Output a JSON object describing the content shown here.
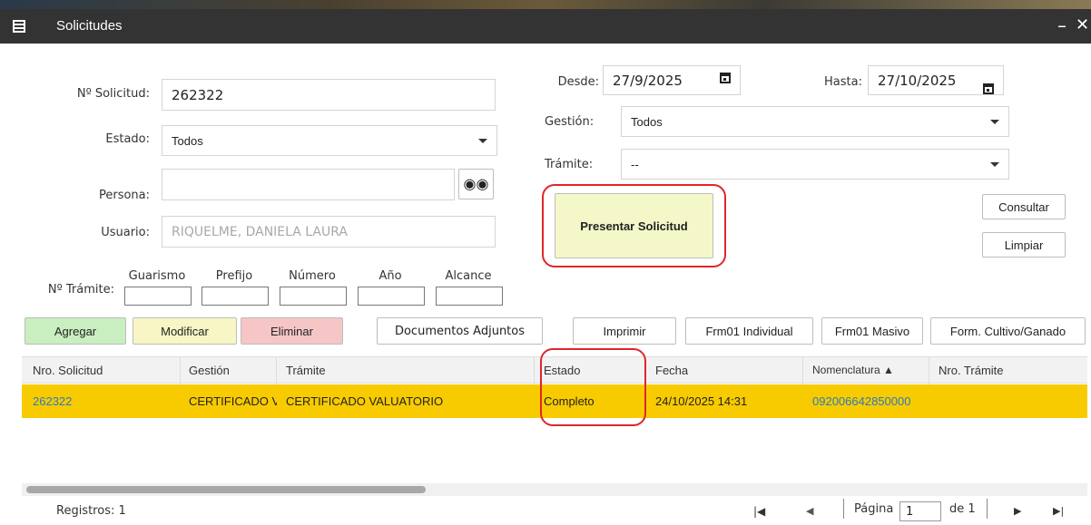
{
  "window": {
    "title": "Solicitudes",
    "minimize": "–",
    "close": "✕"
  },
  "form": {
    "nro_solicitud": {
      "label": "Nº Solicitud:",
      "value": "262322"
    },
    "estado": {
      "label": "Estado:",
      "value": "Todos"
    },
    "persona": {
      "label": "Persona:",
      "value": ""
    },
    "usuario": {
      "label": "Usuario:",
      "value": "RIQUELME, DANIELA LAURA"
    },
    "tramite_nro": {
      "label": "Nº Trámite:",
      "subs": [
        "Guarismo",
        "Prefijo",
        "Número",
        "Año",
        "Alcance"
      ]
    },
    "desde": {
      "label": "Desde:",
      "value": "27/9/2025"
    },
    "hasta": {
      "label": "Hasta:",
      "value": "27/10/2025"
    },
    "gestion": {
      "label": "Gestión:",
      "value": "Todos"
    },
    "tramite": {
      "label": "Trámite:",
      "value": "--"
    }
  },
  "buttons": {
    "presentar": "Presentar Solicitud",
    "consultar": "Consultar",
    "limpiar": "Limpiar",
    "agregar": "Agregar",
    "modificar": "Modificar",
    "eliminar": "Eliminar",
    "documentos": "Documentos Adjuntos",
    "imprimir": "Imprimir",
    "frm_individual": "Frm01 Individual",
    "frm_masivo": "Frm01 Masivo",
    "form_cultivo": "Form. Cultivo/Ganado"
  },
  "grid": {
    "columns": [
      "Nro. Solicitud",
      "Gestión",
      "Trámite",
      "Estado",
      "Fecha",
      "Nomenclatura ▲",
      "Nro. Trámite"
    ],
    "rows": [
      {
        "nro_solicitud": "262322",
        "gestion": "CERTIFICADO VALUATORIO",
        "tramite": "CERTIFICADO VALUATORIO",
        "estado": "Completo",
        "fecha": "24/10/2025 14:31",
        "nomenclatura": "092006642850000",
        "nro_tramite": ""
      }
    ]
  },
  "footer": {
    "registros": "Registros: 1",
    "pagina_label": "Página",
    "pagina_value": "1",
    "de": "de 1",
    "first": "|◀",
    "prev": "◀",
    "next": "▶",
    "last": "▶|"
  },
  "colors": {
    "selected_row": "#f8cb00",
    "agregar_bg": "#c9eebf",
    "modificar_bg": "#f7f6c4",
    "eliminar_bg": "#f6c6c6",
    "presentar_bg": "#f4f7c8",
    "highlight": "#e0262a",
    "link": "#2a7bbf"
  }
}
